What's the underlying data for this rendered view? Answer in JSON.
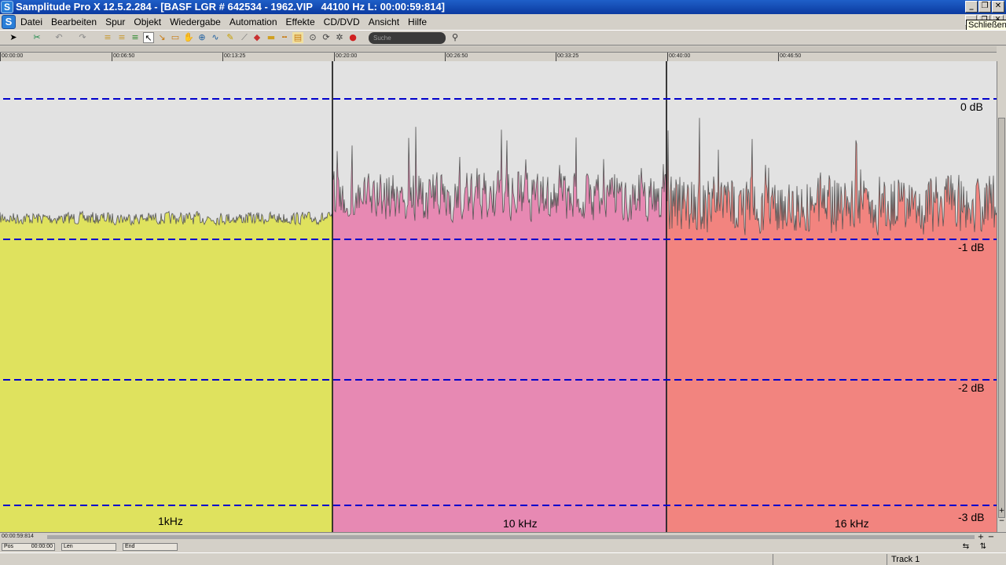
{
  "window": {
    "title": "Samplitude Pro X 12.5.2.284 - [BASF LGR # 642534 - 1962.VIP   44100 Hz L: 00:00:59:814]",
    "app_icon": "S",
    "buttons": {
      "minimize": "_",
      "restore": "❐",
      "close": "✕"
    }
  },
  "menubar": {
    "doc_icon": "S",
    "items": [
      "Datei",
      "Bearbeiten",
      "Spur",
      "Objekt",
      "Wiedergabe",
      "Automation",
      "Effekte",
      "CD/DVD",
      "Ansicht",
      "Hilfe"
    ],
    "tooltip": "Schließen"
  },
  "toolbar": {
    "search_placeholder": "Suche",
    "icons": [
      "pointer-icon",
      "cut-icon",
      "undo-icon",
      "redo-icon",
      "list-icon",
      "list-icon",
      "list-icon",
      "select-icon",
      "range-icon",
      "object-icon",
      "hand-icon",
      "zoom-icon",
      "curve-icon",
      "pencil-icon",
      "scrub-icon",
      "marker-icon",
      "volume-icon",
      "split-icon",
      "effect-icon",
      "zoom-search-icon",
      "loop-icon",
      "settings-icon",
      "record-icon"
    ]
  },
  "ruler": {
    "ticks": [
      "00:00:00",
      "00:06:50",
      "00:13:25",
      "00:20:00",
      "00:26:50",
      "00:33:25",
      "00:40:00",
      "00:46:50"
    ]
  },
  "wave": {
    "db_labels": [
      "0 dB",
      "-1 dB",
      "-2 dB",
      "-3 dB"
    ],
    "clips": [
      {
        "label": "1kHz",
        "color": "#dfe25e",
        "level": -0.85
      },
      {
        "label": "10 kHz",
        "color": "#e789b3",
        "level": -0.7
      },
      {
        "label": "16 kHz",
        "color": "#f2847f",
        "level": -0.75
      }
    ],
    "background": "#e2e2e2",
    "grid_color": "#0000cc"
  },
  "hscroll": {
    "position": "00:00:59:814"
  },
  "posbar": {
    "pos_label": "Pos",
    "pos_value": "00:00:00",
    "len_label": "Len",
    "end_label": "End"
  },
  "statusbar": {
    "track": "Track 1"
  }
}
